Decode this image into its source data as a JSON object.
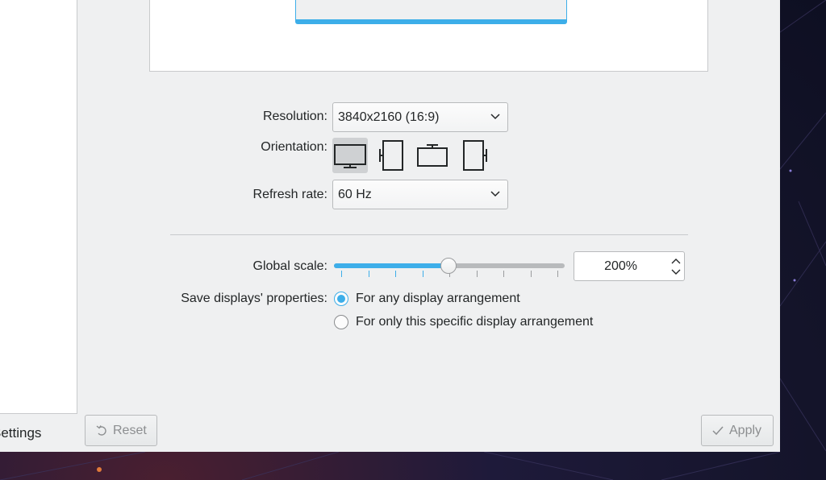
{
  "sidebar": {
    "footer_label": "Settings"
  },
  "form": {
    "resolution_label": "Resolution:",
    "resolution_value": "3840x2160 (16:9)",
    "orientation_label": "Orientation:",
    "orientation_options": [
      "landscape-icon",
      "portrait-left-icon",
      "landscape-flipped-icon",
      "portrait-right-icon"
    ],
    "orientation_selected_index": 0,
    "refresh_label": "Refresh rate:",
    "refresh_value": "60 Hz",
    "scale_label": "Global scale:",
    "scale_value": "200%",
    "scale_slider_fraction": 0.5,
    "save_label": "Save displays' properties:",
    "save_options": [
      {
        "label": "For any display arrangement",
        "checked": true
      },
      {
        "label": "For only this specific display arrangement",
        "checked": false
      }
    ]
  },
  "footer": {
    "reset_label": "Reset",
    "apply_label": "Apply"
  },
  "colors": {
    "accent": "#3daee9",
    "window_bg": "#eff0f1",
    "disabled_text": "#8c8e90"
  }
}
